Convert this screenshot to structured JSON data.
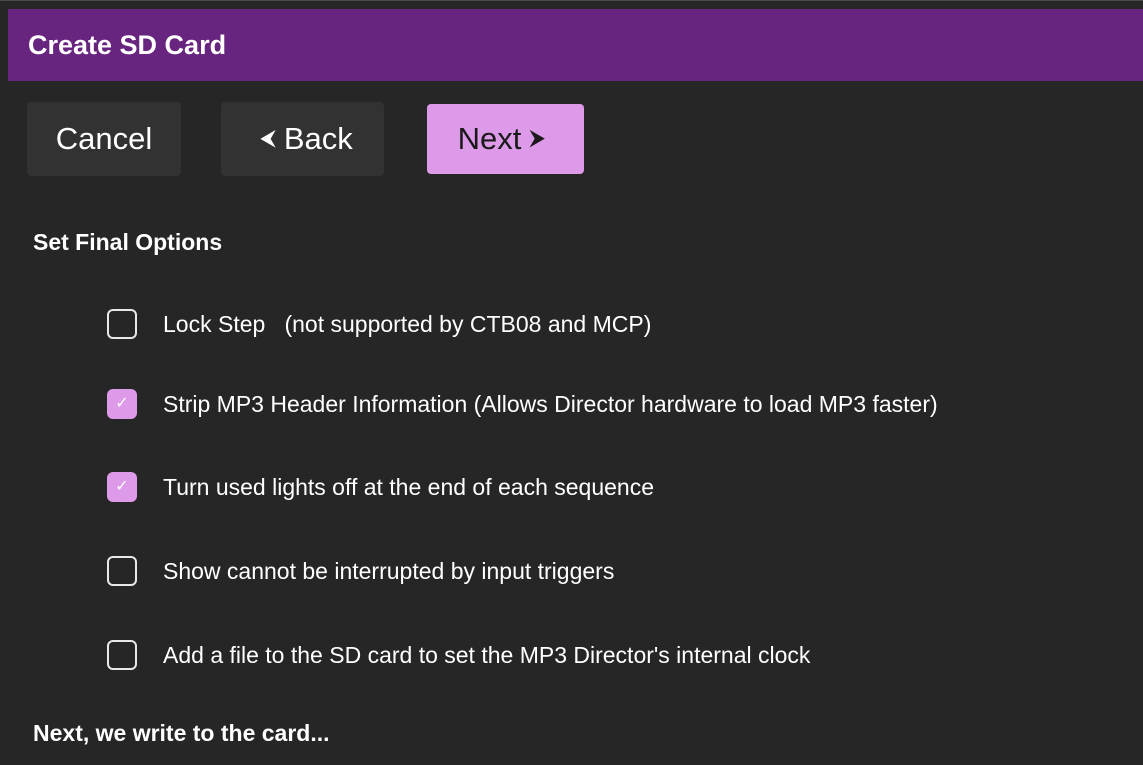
{
  "window": {
    "title": "Create SD Card"
  },
  "toolbar": {
    "cancel_label": "Cancel",
    "back_label": "Back",
    "back_glyph": "⮜",
    "next_label": "Next",
    "next_glyph": "⮞"
  },
  "section": {
    "heading": "Set Final Options"
  },
  "options": [
    {
      "label": "Lock Step   (not supported by CTB08 and MCP)",
      "checked": false
    },
    {
      "label": "Strip MP3 Header Information (Allows Director hardware to load MP3 faster)",
      "checked": true
    },
    {
      "label": "Turn used lights off at the end of each sequence",
      "checked": true
    },
    {
      "label": "Show cannot be interrupted by input triggers",
      "checked": false
    },
    {
      "label": "Add a file to the SD card to set the MP3 Director's internal clock",
      "checked": false
    }
  ],
  "footer": {
    "text": "Next, we write to the card..."
  },
  "colors": {
    "titlebar": "#68257f",
    "background": "#262626",
    "button": "#323232",
    "accent": "#dd9ae8"
  },
  "icons": {
    "back": "chevron-left-icon",
    "next": "chevron-right-icon",
    "check": "check-icon"
  }
}
